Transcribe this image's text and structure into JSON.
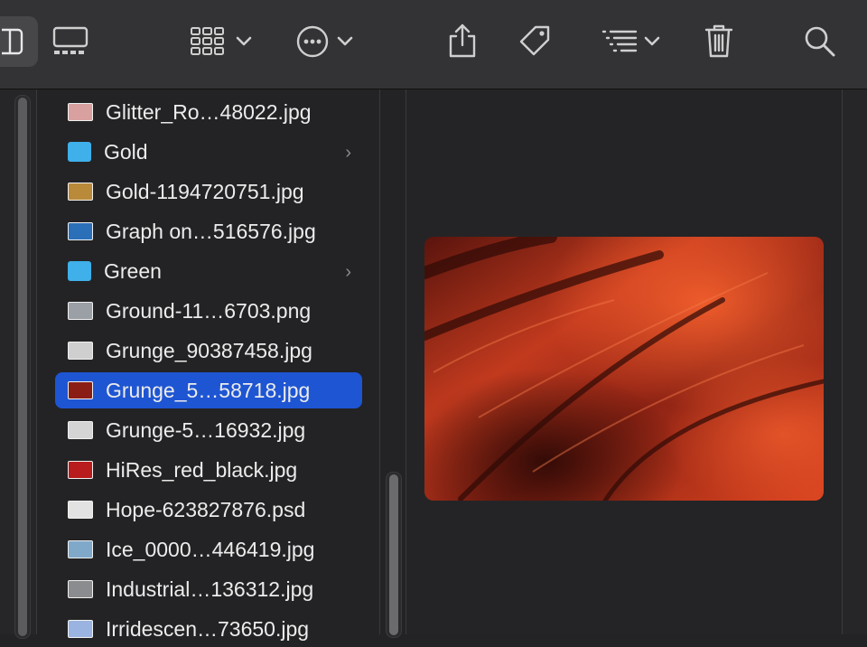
{
  "toolbar": {
    "buttons": [
      {
        "name": "view-columns-button",
        "icon": "columns-icon"
      },
      {
        "name": "view-gallery-button",
        "icon": "gallery-icon"
      },
      {
        "name": "group-button",
        "icon": "grid-icon"
      },
      {
        "name": "action-button",
        "icon": "ellipsis-circle-icon"
      },
      {
        "name": "share-button",
        "icon": "share-icon"
      },
      {
        "name": "tag-button",
        "icon": "tag-icon"
      },
      {
        "name": "sort-button",
        "icon": "list-icon"
      },
      {
        "name": "delete-button",
        "icon": "trash-icon"
      },
      {
        "name": "search-button",
        "icon": "search-icon"
      }
    ]
  },
  "files": [
    {
      "name": "Glitter_Ro…48022.jpg",
      "thumb": "#d9a0a0",
      "folder": false
    },
    {
      "name": "Gold",
      "thumb": "#3fb0ea",
      "folder": true
    },
    {
      "name": "Gold-1194720751.jpg",
      "thumb": "#b98a3a",
      "folder": false
    },
    {
      "name": "Graph on…516576.jpg",
      "thumb": "#2b6fb8",
      "folder": false
    },
    {
      "name": "Green",
      "thumb": "#3fb0ea",
      "folder": true
    },
    {
      "name": "Ground-11…6703.png",
      "thumb": "#9aa0a6",
      "folder": false
    },
    {
      "name": "Grunge_90387458.jpg",
      "thumb": "#cfcfcf",
      "folder": false
    },
    {
      "name": "Grunge_5…58718.jpg",
      "thumb": "#8a1e14",
      "folder": false,
      "selected": true
    },
    {
      "name": "Grunge-5…16932.jpg",
      "thumb": "#d4d4d4",
      "folder": false
    },
    {
      "name": "HiRes_red_black.jpg",
      "thumb": "#b81c1c",
      "folder": false
    },
    {
      "name": "Hope-623827876.psd",
      "thumb": "#e2e2e2",
      "folder": false
    },
    {
      "name": "Ice_0000…446419.jpg",
      "thumb": "#7fa8c9",
      "folder": false
    },
    {
      "name": "Industrial…136312.jpg",
      "thumb": "#8a8c90",
      "folder": false
    },
    {
      "name": "Irridescen…73650.jpg",
      "thumb": "#9ab3e0",
      "folder": false
    }
  ],
  "colors": {
    "selection": "#1e55d3",
    "preview_base": "#b8321c",
    "preview_dark": "#3a0c08",
    "preview_bright": "#f0562a"
  }
}
